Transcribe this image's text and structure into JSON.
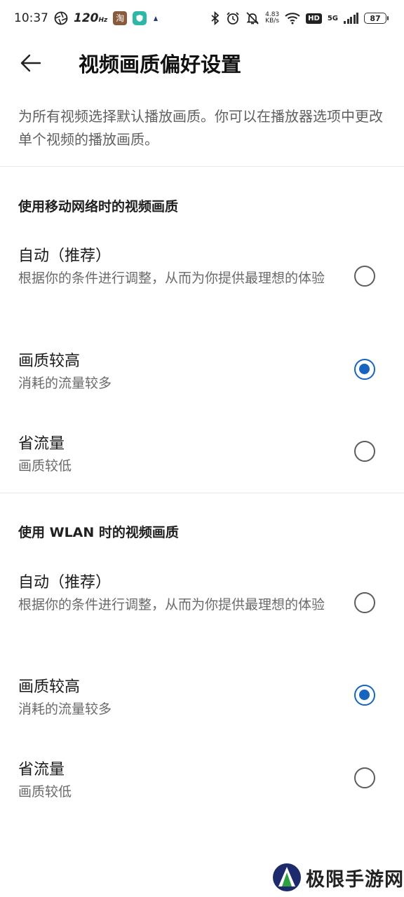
{
  "status_bar": {
    "time": "10:37",
    "refresh_rate": "120",
    "refresh_unit": "Hz",
    "app_icon_1": "淘",
    "net_speed_value": "4.83",
    "net_speed_unit": "KB/s",
    "hd_badge": "HD",
    "network_type": "5G",
    "battery_level": "87",
    "icons": [
      "aperture-icon",
      "shop-app-icon",
      "shield-app-icon",
      "notification-dot-icon",
      "bluetooth-icon",
      "alarm-icon",
      "mute-icon",
      "wifi-icon",
      "signal-icon",
      "battery-icon"
    ]
  },
  "header": {
    "back_icon": "arrow-left-icon",
    "title": "视频画质偏好设置"
  },
  "intro_text": "为所有视频选择默认播放画质。你可以在播放器选项中更改单个视频的播放画质。",
  "sections": [
    {
      "title": "使用移动网络时的视频画质",
      "options": [
        {
          "title": "自动（推荐）",
          "desc": "根据你的条件进行调整，从而为你提供最理想的体验",
          "selected": false
        },
        {
          "title": "画质较高",
          "desc": "消耗的流量较多",
          "selected": true
        },
        {
          "title": "省流量",
          "desc": "画质较低",
          "selected": false
        }
      ]
    },
    {
      "title": "使用 WLAN 时的视频画质",
      "options": [
        {
          "title": "自动（推荐）",
          "desc": "根据你的条件进行调整，从而为你提供最理想的体验",
          "selected": false
        },
        {
          "title": "画质较高",
          "desc": "消耗的流量较多",
          "selected": true
        },
        {
          "title": "省流量",
          "desc": "画质较低",
          "selected": false
        }
      ]
    }
  ],
  "colors": {
    "accent": "#1565c0",
    "text_primary": "#1b1b1b",
    "text_secondary": "#6a6a6a",
    "divider": "#e8e8e8"
  },
  "watermark": {
    "text": "极限手游网"
  }
}
